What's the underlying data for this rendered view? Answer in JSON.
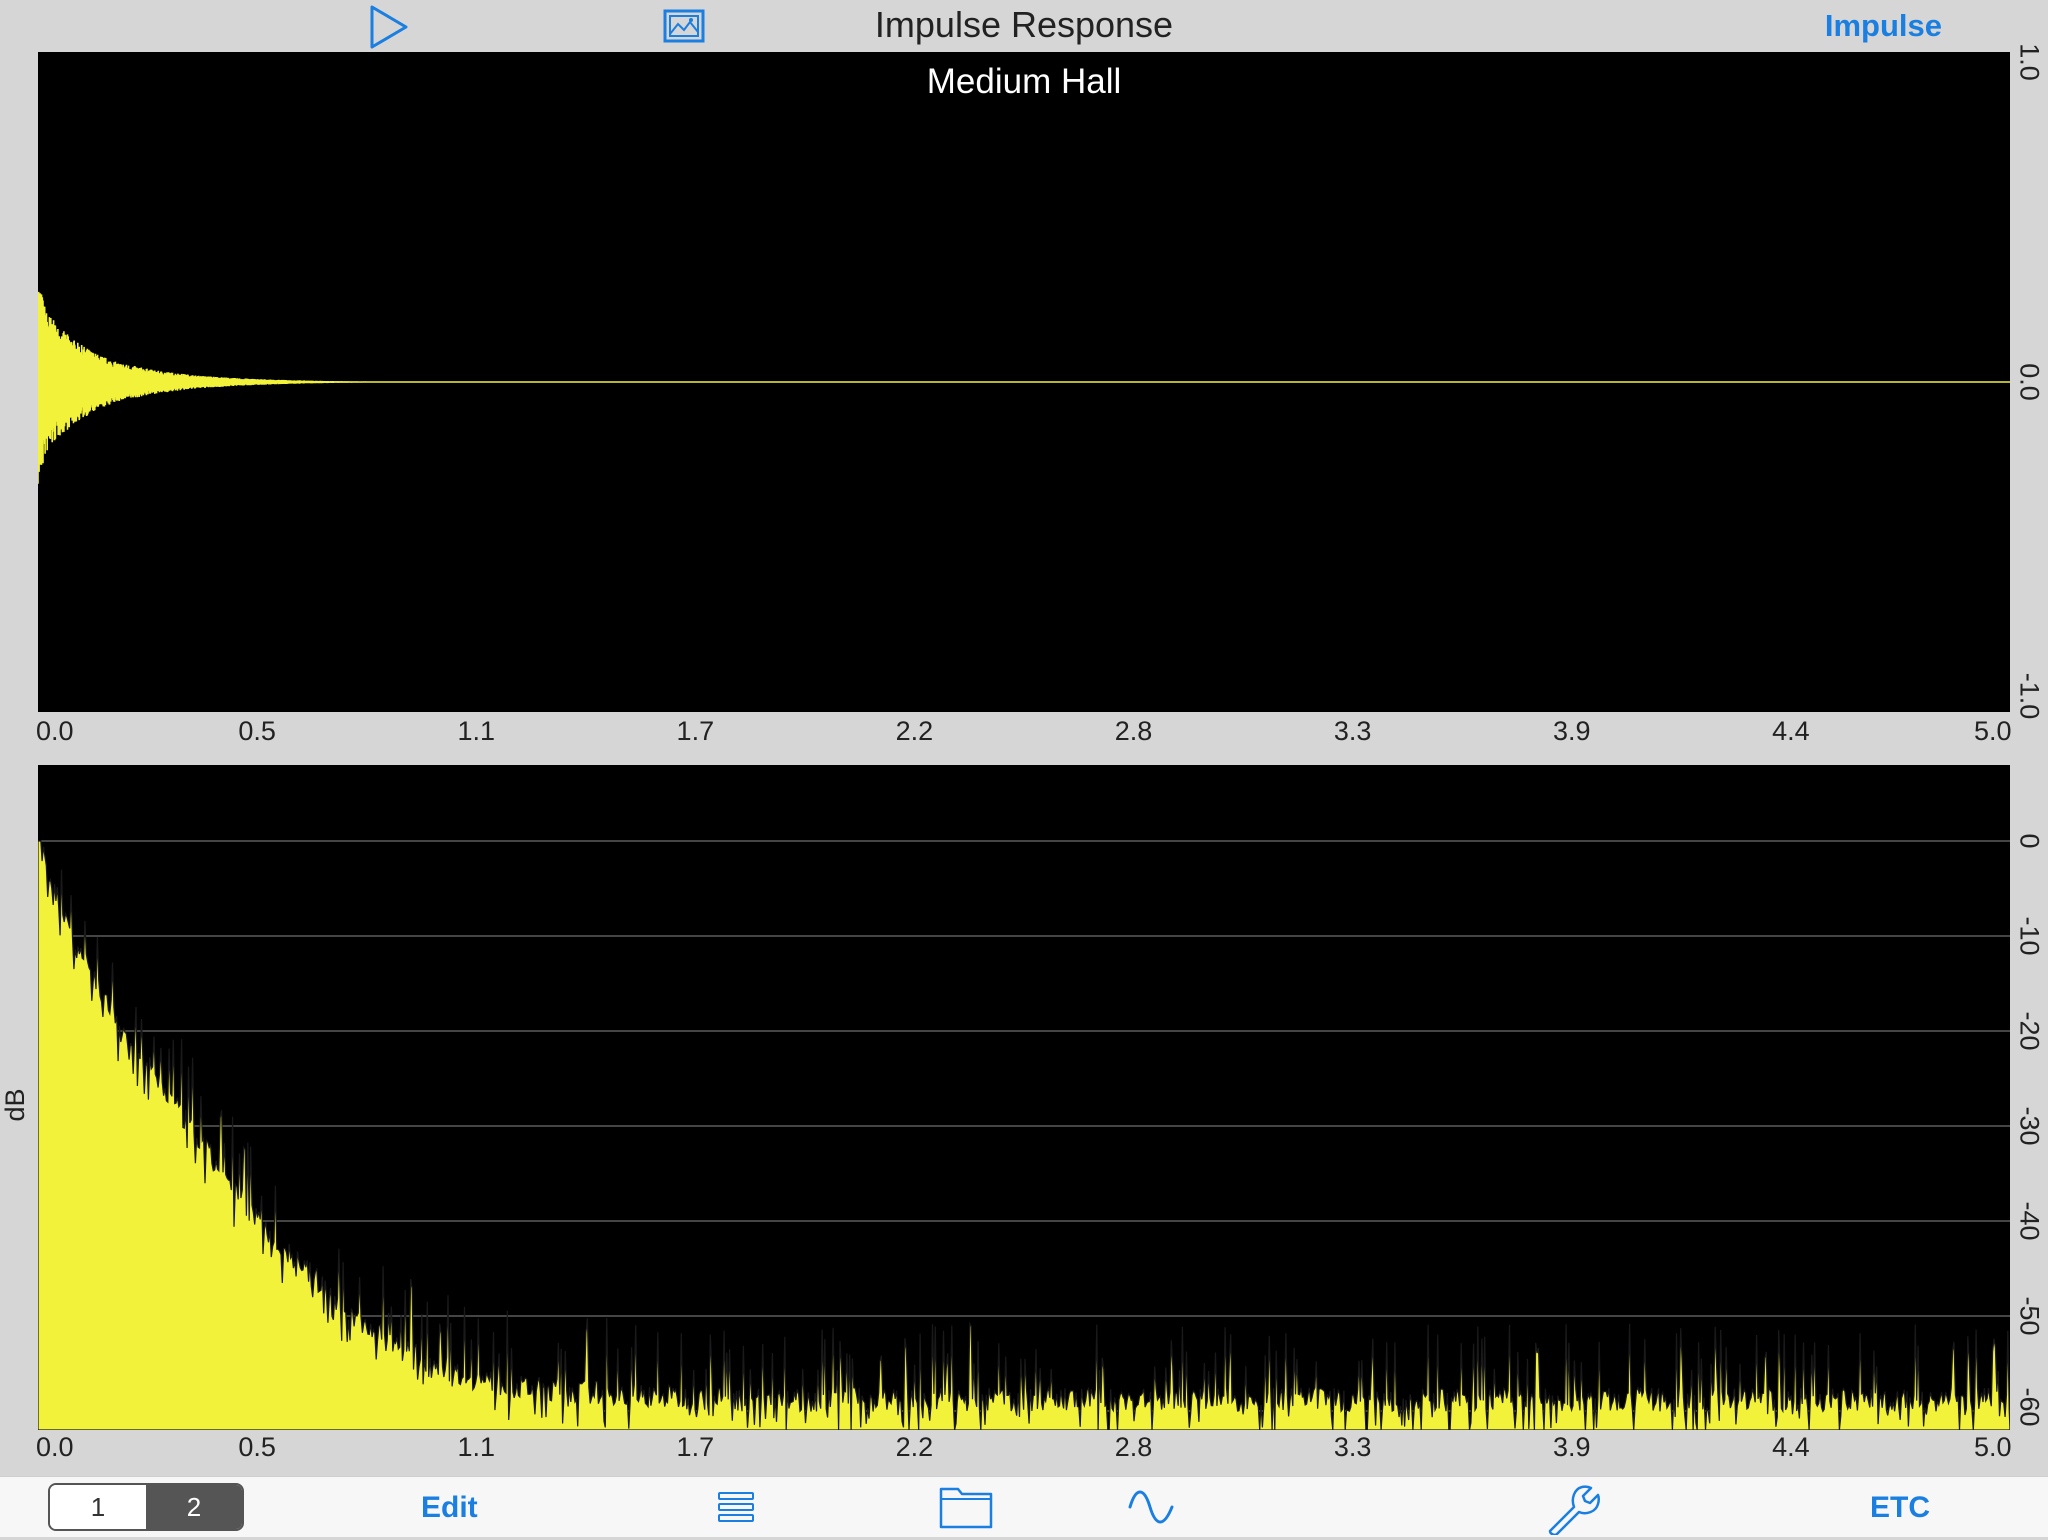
{
  "header": {
    "title": "Impulse Response",
    "mode_label": "Impulse",
    "play_icon": "play-icon",
    "image_icon": "image-icon"
  },
  "colors": {
    "accent": "#1a7fe0",
    "trace": "#f2f23a",
    "plot_bg": "#000000",
    "chrome": "#d6d6d6"
  },
  "chart_data": [
    {
      "type": "area",
      "title": "Medium Hall",
      "xlabel": "",
      "ylabel": "",
      "xlim": [
        0.0,
        5.0
      ],
      "ylim": [
        -1.0,
        1.0
      ],
      "x_tick_labels": [
        "0.0",
        "0.5",
        "1.1",
        "1.7",
        "2.2",
        "2.8",
        "3.3",
        "3.9",
        "4.4",
        "5.0"
      ],
      "y_tick_labels": [
        "1.0",
        "0.0",
        "-1.0"
      ],
      "envelope": {
        "x": [
          0.0,
          0.02,
          0.05,
          0.1,
          0.15,
          0.2,
          0.3,
          0.4,
          0.5,
          0.6,
          0.7,
          0.8,
          1.0,
          5.0
        ],
        "amplitude": [
          0.32,
          0.22,
          0.17,
          0.12,
          0.085,
          0.06,
          0.035,
          0.02,
          0.012,
          0.007,
          0.004,
          0.002,
          0.0,
          0.0
        ]
      },
      "grid": false
    },
    {
      "type": "area",
      "title": "",
      "xlabel": "",
      "ylabel": "dB",
      "xlim": [
        0.0,
        5.0
      ],
      "ylim": [
        -62,
        8
      ],
      "x_tick_labels": [
        "0.0",
        "0.5",
        "1.1",
        "1.7",
        "2.2",
        "2.8",
        "3.3",
        "3.9",
        "4.4",
        "5.0"
      ],
      "y_ticks": [
        0,
        -10,
        -20,
        -30,
        -40,
        -50,
        -60
      ],
      "y_tick_labels": [
        "0",
        "-10",
        "-20",
        "-30",
        "-40",
        "-50",
        "-60"
      ],
      "decay": {
        "x": [
          0.0,
          0.05,
          0.1,
          0.2,
          0.3,
          0.4,
          0.5,
          0.6,
          0.7,
          0.8,
          0.9,
          1.0,
          1.1,
          1.2,
          1.4,
          1.6,
          1.7,
          5.0
        ],
        "db": [
          0,
          -6,
          -11,
          -19,
          -25,
          -31,
          -37,
          -42,
          -46,
          -50,
          -53,
          -55,
          -56.5,
          -57.5,
          -58,
          -58.5,
          -58.8,
          -58.8
        ]
      },
      "grid": true
    }
  ],
  "toolbar": {
    "segment_1": "1",
    "segment_2": "2",
    "edit_label": "Edit",
    "list_icon": "list-icon",
    "folder_icon": "folder-icon",
    "wave_icon": "sine-wave-icon",
    "settings_icon": "wrench-icon",
    "etc_label": "ETC"
  }
}
